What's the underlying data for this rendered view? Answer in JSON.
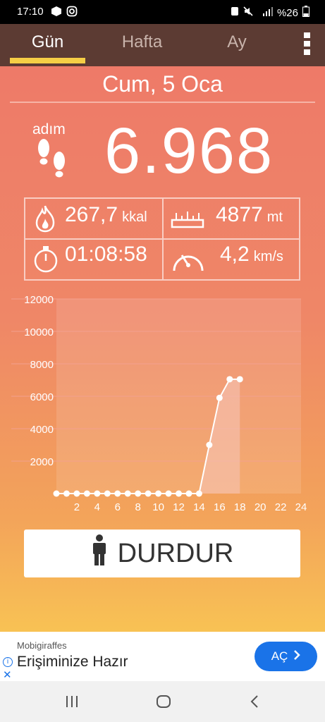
{
  "status_bar": {
    "time": "17:10",
    "battery": "%26",
    "left_icons": [
      "box-icon",
      "instagram-icon"
    ],
    "right_icons": [
      "sim-icon",
      "mute-icon",
      "signal-4g-icon",
      "battery-icon"
    ]
  },
  "tabs": [
    {
      "label": "Gün",
      "active": true
    },
    {
      "label": "Hafta",
      "active": false
    },
    {
      "label": "Ay",
      "active": false
    }
  ],
  "date": "Cum, 5 Oca",
  "steps": {
    "label": "adım",
    "count": "6.968"
  },
  "stats": {
    "calories": {
      "value": "267,7",
      "unit": "kkal"
    },
    "distance": {
      "value": "4877",
      "unit": "mt"
    },
    "duration": {
      "value": "01:08:58"
    },
    "speed": {
      "value": "4,2",
      "unit": "km/s"
    }
  },
  "chart_data": {
    "type": "area",
    "x": [
      0,
      1,
      2,
      3,
      4,
      5,
      6,
      7,
      8,
      9,
      10,
      11,
      12,
      13,
      14,
      15,
      16,
      17,
      18
    ],
    "values": [
      0,
      0,
      0,
      0,
      0,
      0,
      0,
      0,
      0,
      0,
      0,
      0,
      0,
      0,
      0,
      3000,
      5900,
      7050,
      7050
    ],
    "ylim": [
      0,
      12000
    ],
    "yticks": [
      2000,
      4000,
      6000,
      8000,
      10000,
      12000
    ],
    "xlim": [
      0,
      24
    ],
    "xticks": [
      2,
      4,
      6,
      8,
      10,
      12,
      14,
      16,
      18,
      20,
      22,
      24
    ],
    "grid": true,
    "colors": {
      "line": "#ffffff",
      "fill": "#f6c3b4",
      "grid": "#f3a08f"
    }
  },
  "stop_button": {
    "label": "DURDUR"
  },
  "ad": {
    "brand": "Mobigiraffes",
    "title": "Erişiminize Hazır",
    "cta": "AÇ"
  },
  "colors": {
    "tab_bar": "#5c3b33",
    "accent": "#f6ce45",
    "ad_blue": "#1a73e8"
  }
}
